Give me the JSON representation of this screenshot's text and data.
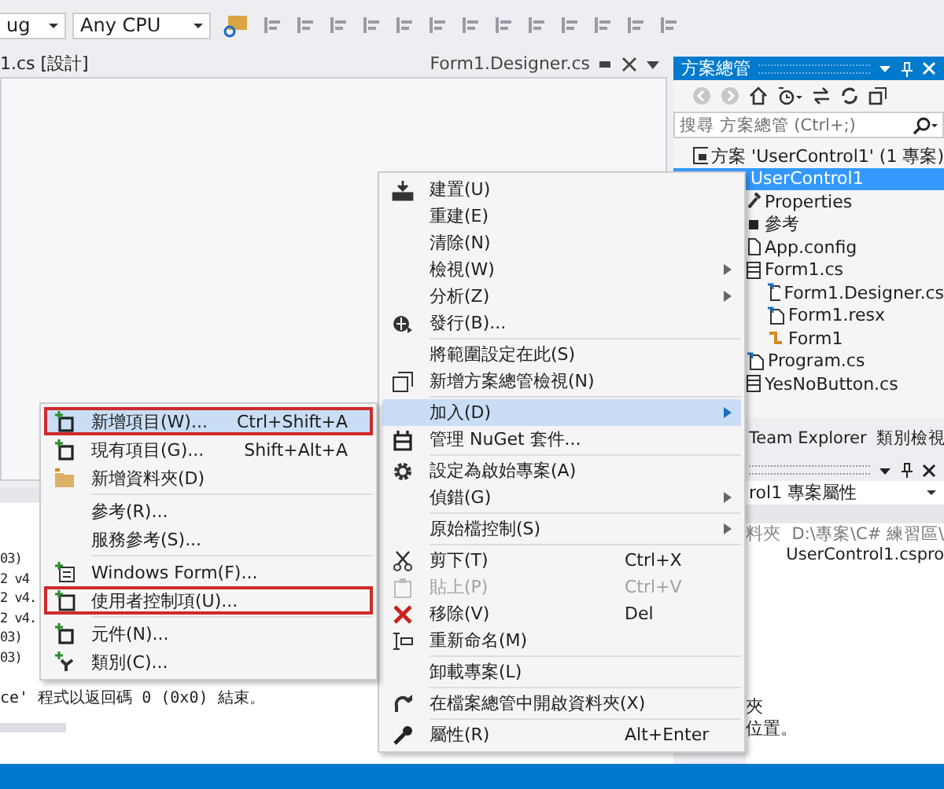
{
  "toolbar": {
    "configuration": "ug",
    "platform": "Any CPU"
  },
  "editor_tabs": [
    {
      "label": "1.cs [設計]",
      "selected": true
    },
    {
      "label": "Form1.Designer.cs",
      "selected": false
    }
  ],
  "output": {
    "lines": [
      "03)",
      "2 v4",
      "2 v4.",
      "2 v4.",
      "03)",
      "03)"
    ],
    "last_line": "ce' 程式以返回碼 0 (0x0) 結束。"
  },
  "solution_explorer": {
    "title": "方案總管",
    "search": {
      "placeholder": "搜尋 方案總管 (Ctrl+;)"
    },
    "tree": [
      {
        "label": "方案 'UserControl1' (1 專案)",
        "kind": "solution",
        "selected": false,
        "children": [
          {
            "label": "UserControl1",
            "selected": true,
            "children": [
              {
                "label": "Properties",
                "kind": "properties",
                "selected": false
              },
              {
                "label": "參考",
                "kind": "references",
                "selected": false
              },
              {
                "label": "App.config",
                "kind": "config",
                "selected": false
              },
              {
                "label": "Form1.cs",
                "kind": "form",
                "selected": false,
                "children": [
                  {
                    "label": "Form1.Designer.cs",
                    "kind": "code",
                    "selected": false
                  },
                  {
                    "label": "Form1.resx",
                    "kind": "code",
                    "selected": false
                  },
                  {
                    "label": "Form1",
                    "kind": "class",
                    "selected": false
                  }
                ]
              },
              {
                "label": "Program.cs",
                "kind": "code",
                "selected": false
              },
              {
                "label": "YesNoButton.cs",
                "kind": "form",
                "selected": false
              }
            ]
          }
        ]
      }
    ]
  },
  "panel_tabs": [
    {
      "label": "Team Explorer",
      "selected": false
    },
    {
      "label": "類別檢視",
      "selected": false
    }
  ],
  "properties": {
    "dropdown": "rol1 專案屬性",
    "rows": [
      {
        "name": "料夾",
        "value": "D:\\專案\\C# 練習區\\"
      },
      {
        "value": "UserControl1.cspro"
      }
    ],
    "description": [
      "夾",
      "位置。"
    ]
  },
  "context_menu": {
    "items": [
      {
        "kind": "item",
        "label": "建置(U)"
      },
      {
        "kind": "item",
        "label": "重建(E)"
      },
      {
        "kind": "item",
        "label": "清除(N)"
      },
      {
        "kind": "item",
        "label": "檢視(W)",
        "submenu": true
      },
      {
        "kind": "item",
        "label": "分析(Z)",
        "submenu": true
      },
      {
        "kind": "item",
        "label": "發行(B)..."
      },
      {
        "kind": "separator"
      },
      {
        "kind": "item",
        "label": "將範圍設定在此(S)"
      },
      {
        "kind": "item",
        "label": "新增方案總管檢視(N)"
      },
      {
        "kind": "separator"
      },
      {
        "kind": "item",
        "label": "加入(D)",
        "submenu": true,
        "selected": true
      },
      {
        "kind": "item",
        "label": "管理 NuGet 套件..."
      },
      {
        "kind": "separator"
      },
      {
        "kind": "item",
        "label": "設定為啟始專案(A)"
      },
      {
        "kind": "item",
        "label": "偵錯(G)",
        "submenu": true
      },
      {
        "kind": "separator"
      },
      {
        "kind": "item",
        "label": "原始檔控制(S)",
        "submenu": true
      },
      {
        "kind": "separator"
      },
      {
        "kind": "item",
        "label": "剪下(T)",
        "shortcut": "Ctrl+X"
      },
      {
        "kind": "item",
        "label": "貼上(P)",
        "shortcut": "Ctrl+V",
        "disabled": true
      },
      {
        "kind": "item",
        "label": "移除(V)",
        "shortcut": "Del"
      },
      {
        "kind": "item",
        "label": "重新命名(M)"
      },
      {
        "kind": "separator"
      },
      {
        "kind": "item",
        "label": "卸載專案(L)"
      },
      {
        "kind": "separator"
      },
      {
        "kind": "item",
        "label": "在檔案總管中開啟資料夾(X)"
      },
      {
        "kind": "separator"
      },
      {
        "kind": "item",
        "label": "屬性(R)",
        "shortcut": "Alt+Enter"
      }
    ]
  },
  "submenu": {
    "items": [
      {
        "kind": "item",
        "label": "新增項目(W)...",
        "shortcut": "Ctrl+Shift+A",
        "selected": true,
        "outlined": true
      },
      {
        "kind": "item",
        "label": "現有項目(G)...",
        "shortcut": "Shift+Alt+A"
      },
      {
        "kind": "item",
        "label": "新增資料夾(D)"
      },
      {
        "kind": "separator"
      },
      {
        "kind": "item",
        "label": "參考(R)..."
      },
      {
        "kind": "item",
        "label": "服務參考(S)..."
      },
      {
        "kind": "separator"
      },
      {
        "kind": "item",
        "label": "Windows Form(F)..."
      },
      {
        "kind": "item",
        "label": "使用者控制項(U)...",
        "outlined": true
      },
      {
        "kind": "separator"
      },
      {
        "kind": "item",
        "label": "元件(N)..."
      },
      {
        "kind": "item",
        "label": "類別(C)..."
      }
    ]
  }
}
